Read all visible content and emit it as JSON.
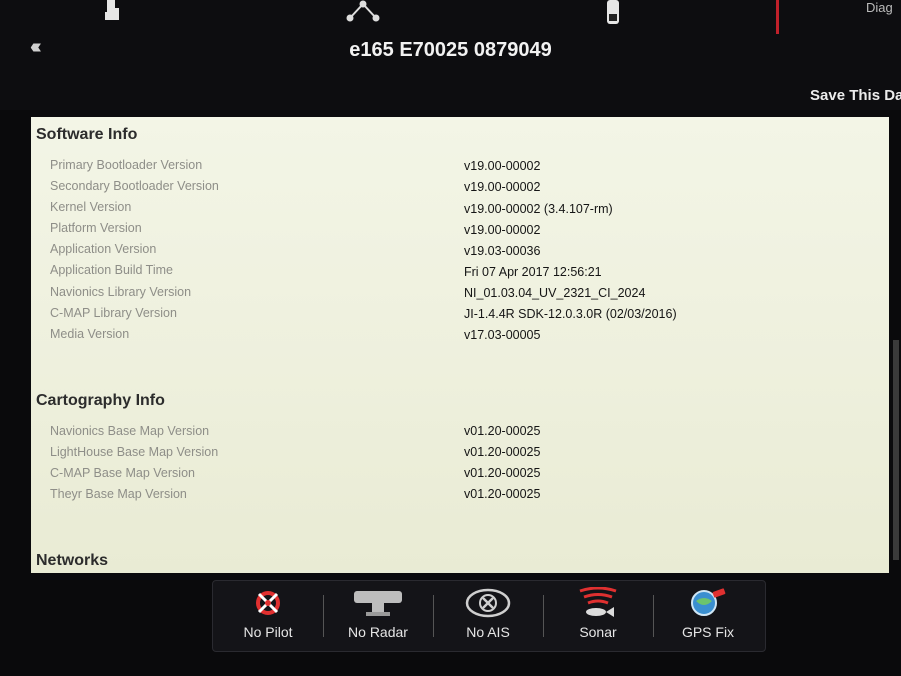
{
  "header": {
    "device_title": "e165 E70025 0879049",
    "save_label": "Save This Da",
    "right_tab_cut": "Diag"
  },
  "software_info": {
    "title": "Software Info",
    "rows": [
      {
        "label": "Primary Bootloader Version",
        "value": "v19.00-00002"
      },
      {
        "label": "Secondary Bootloader Version",
        "value": "v19.00-00002"
      },
      {
        "label": "Kernel Version",
        "value": "v19.00-00002 (3.4.107-rm)"
      },
      {
        "label": "Platform Version",
        "value": "v19.00-00002"
      },
      {
        "label": "Application Version",
        "value": "v19.03-00036"
      },
      {
        "label": "Application Build Time",
        "value": "Fri 07 Apr 2017 12:56:21"
      },
      {
        "label": "Navionics Library Version",
        "value": "NI_01.03.04_UV_2321_CI_2024"
      },
      {
        "label": "C-MAP Library Version",
        "value": "JI-1.4.4R SDK-12.0.3.0R (02/03/2016)"
      },
      {
        "label": "Media Version",
        "value": "v17.03-00005"
      }
    ]
  },
  "cartography_info": {
    "title": "Cartography Info",
    "rows": [
      {
        "label": "Navionics Base Map Version",
        "value": "v01.20-00025"
      },
      {
        "label": "LightHouse Base Map Version",
        "value": "v01.20-00025"
      },
      {
        "label": "C-MAP Base Map Version",
        "value": "v01.20-00025"
      },
      {
        "label": "Theyr Base Map Version",
        "value": "v01.20-00025"
      }
    ]
  },
  "networks": {
    "title": "Networks"
  },
  "status_bar": {
    "items": [
      {
        "label": "No Pilot",
        "icon": "no-pilot-icon"
      },
      {
        "label": "No Radar",
        "icon": "no-radar-icon"
      },
      {
        "label": "No AIS",
        "icon": "no-ais-icon"
      },
      {
        "label": "Sonar",
        "icon": "sonar-icon"
      },
      {
        "label": "GPS Fix",
        "icon": "gps-fix-icon"
      }
    ]
  },
  "colors": {
    "panel_bg": "#f2f4e4",
    "accent_red": "#c0202a",
    "label_gray": "#8e8e88"
  }
}
